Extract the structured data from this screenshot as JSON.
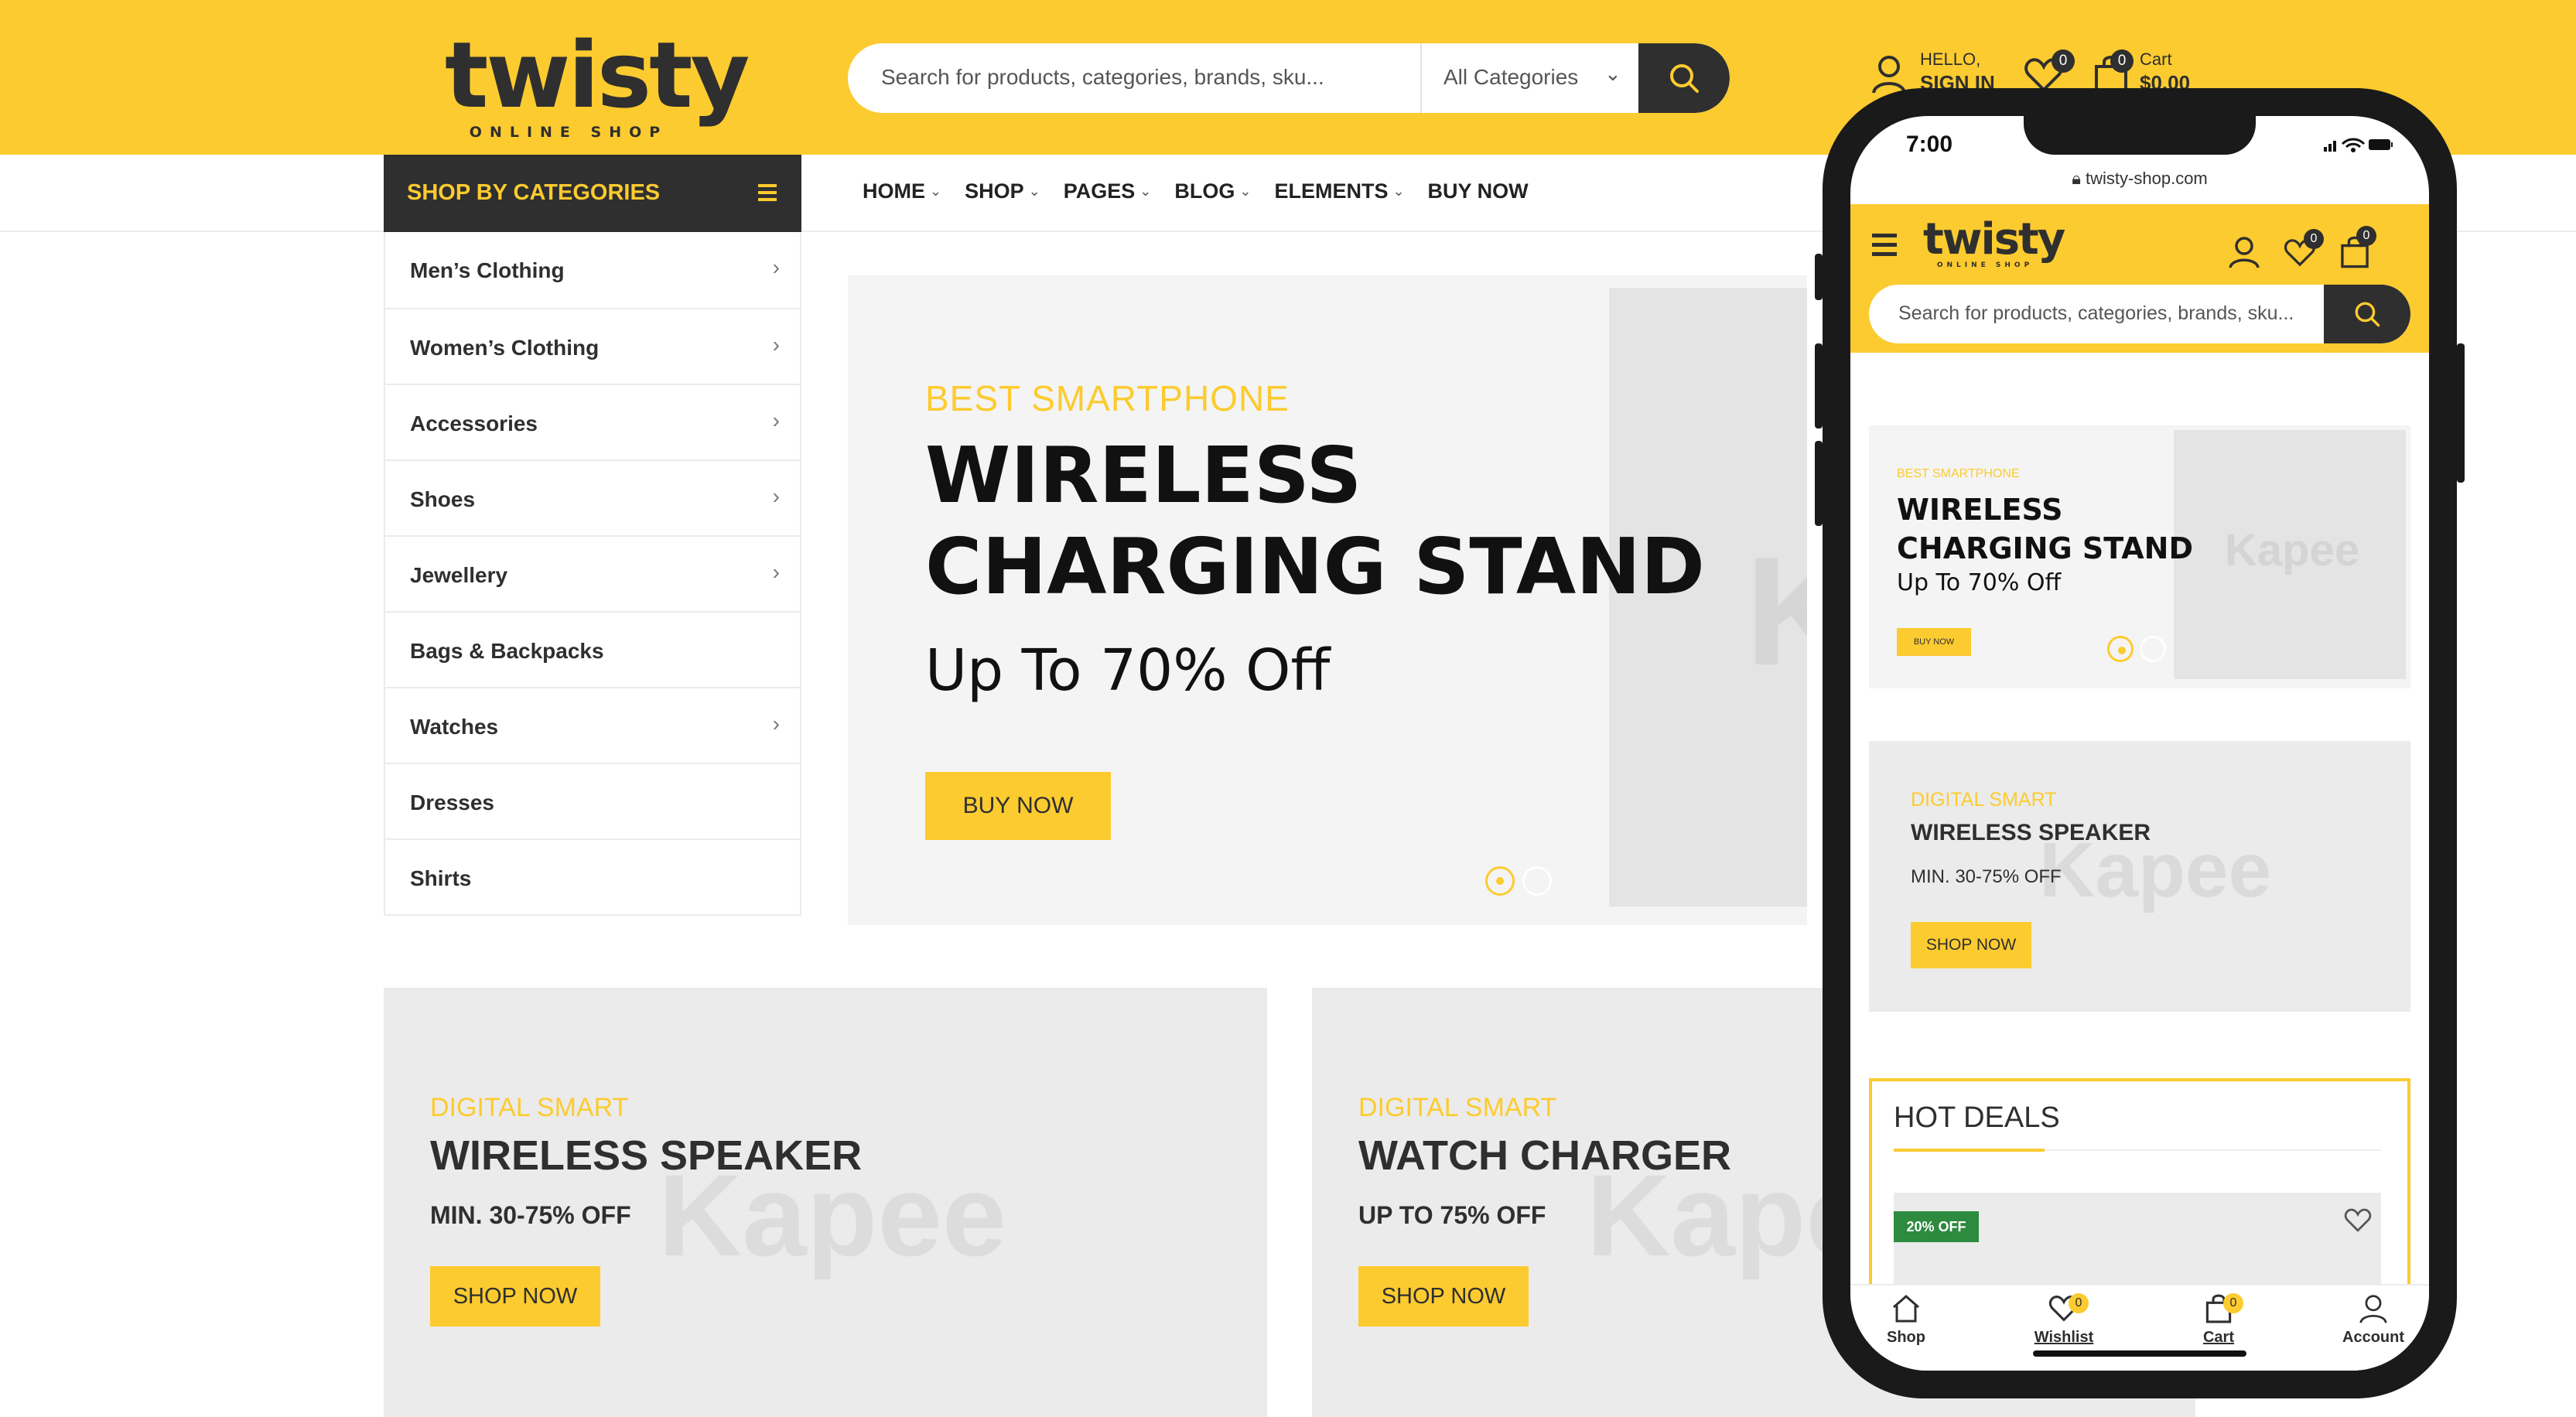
{
  "header": {
    "logo_text": "twisty",
    "logo_sub": "ONLINE SHOP",
    "search_placeholder": "Search for products, categories, brands, sku...",
    "search_category": "All Categories",
    "hello": "HELLO,",
    "sign_in": "SIGN IN",
    "wishlist_count": "0",
    "cart_count": "0",
    "cart_label": "Cart",
    "cart_total": "$0.00"
  },
  "categories": {
    "title": "SHOP BY CATEGORIES",
    "items": [
      {
        "label": "Men’s Clothing",
        "chev": "›"
      },
      {
        "label": "Women’s Clothing",
        "chev": "›"
      },
      {
        "label": "Accessories",
        "chev": "›"
      },
      {
        "label": "Shoes",
        "chev": "›"
      },
      {
        "label": "Jewellery",
        "chev": "›"
      },
      {
        "label": "Bags & Backpacks",
        "chev": ""
      },
      {
        "label": "Watches",
        "chev": "›"
      },
      {
        "label": "Dresses",
        "chev": ""
      },
      {
        "label": "Shirts",
        "chev": ""
      }
    ]
  },
  "nav": {
    "items": [
      {
        "label": "HOME",
        "caret": "⌄"
      },
      {
        "label": "SHOP",
        "caret": "⌄"
      },
      {
        "label": "PAGES",
        "caret": "⌄"
      },
      {
        "label": "BLOG",
        "caret": "⌄"
      },
      {
        "label": "ELEMENTS",
        "caret": "⌄"
      },
      {
        "label": "BUY NOW",
        "caret": ""
      }
    ]
  },
  "hero": {
    "eyebrow": "BEST SMARTPHONE",
    "title_line1": "WIRELESS",
    "title_line2": "CHARGING STAND",
    "subtitle": "Up To 70% Off",
    "button": "BUY NOW",
    "watermark": "Kapee"
  },
  "promos": [
    {
      "eyebrow": "DIGITAL SMART",
      "title": "WIRELESS SPEAKER",
      "sub": "MIN. 30-75% OFF",
      "button": "SHOP NOW",
      "watermark": "Kapee"
    },
    {
      "eyebrow": "DIGITAL SMART",
      "title": "WATCH CHARGER",
      "sub": "UP TO 75% OFF",
      "button": "SHOP NOW",
      "watermark": "Kapee"
    }
  ],
  "mobile": {
    "time": "7:00",
    "url": "twisty-shop.com",
    "wishlist_count": "0",
    "cart_count": "0",
    "hero": {
      "eyebrow": "BEST SMARTPHONE",
      "title_line1": "WIRELESS",
      "title_line2": "CHARGING STAND",
      "subtitle": "Up To 70% Off",
      "button": "BUY NOW",
      "watermark": "Kapee"
    },
    "promo": {
      "eyebrow": "DIGITAL SMART",
      "title": "WIRELESS SPEAKER",
      "sub": "MIN. 30-75% OFF",
      "button": "SHOP NOW",
      "watermark": "Kapee"
    },
    "deals": {
      "title": "HOT DEALS",
      "badge": "20% OFF"
    },
    "tabs": [
      {
        "label": "Shop",
        "icon": "home-icon",
        "badge": ""
      },
      {
        "label": "Wishlist",
        "icon": "heart-icon",
        "badge": "0"
      },
      {
        "label": "Cart",
        "icon": "bag-icon",
        "badge": "0"
      },
      {
        "label": "Account",
        "icon": "user-icon",
        "badge": ""
      }
    ]
  },
  "colors": {
    "accent": "#FCCB2F",
    "dark": "#2f2f2f",
    "deal_badge": "#2e8a3e"
  }
}
